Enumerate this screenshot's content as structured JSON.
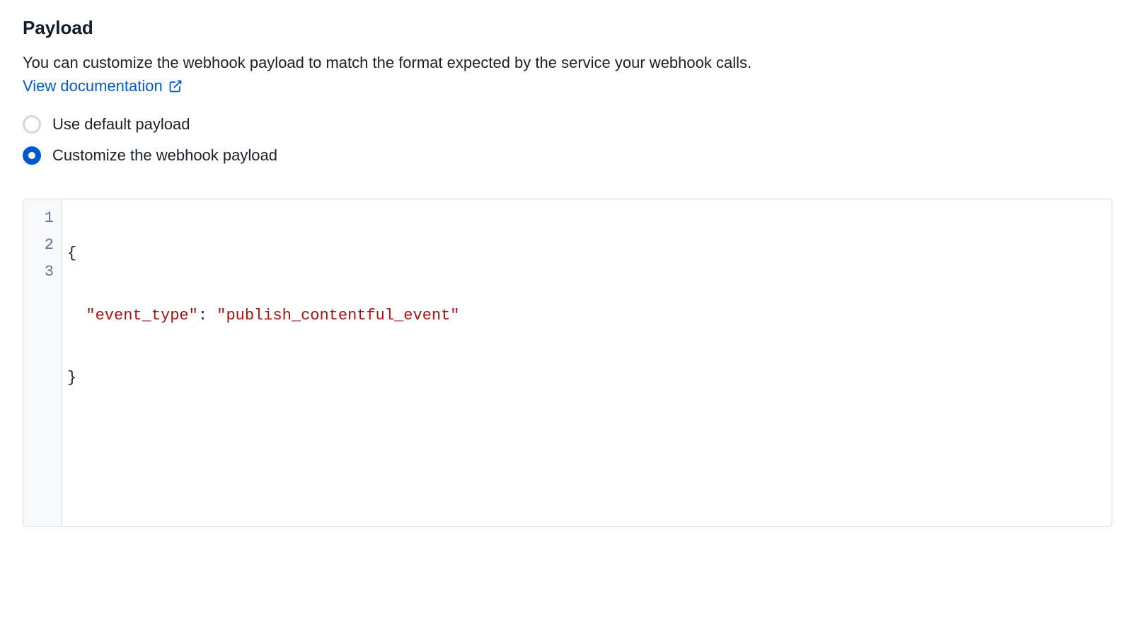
{
  "section": {
    "title": "Payload",
    "description": "You can customize the webhook payload to match the format expected by the service your webhook calls.",
    "doc_link_label": "View documentation"
  },
  "radio": {
    "options": [
      {
        "label": "Use default payload",
        "selected": false
      },
      {
        "label": "Customize the webhook payload",
        "selected": true
      }
    ]
  },
  "editor": {
    "line_numbers": [
      "1",
      "2",
      "3"
    ],
    "lines": [
      {
        "plain": "{"
      },
      {
        "indent": "  ",
        "key": "\"event_type\"",
        "sep": ": ",
        "value": "\"publish_contentful_event\""
      },
      {
        "plain": "}"
      }
    ]
  }
}
